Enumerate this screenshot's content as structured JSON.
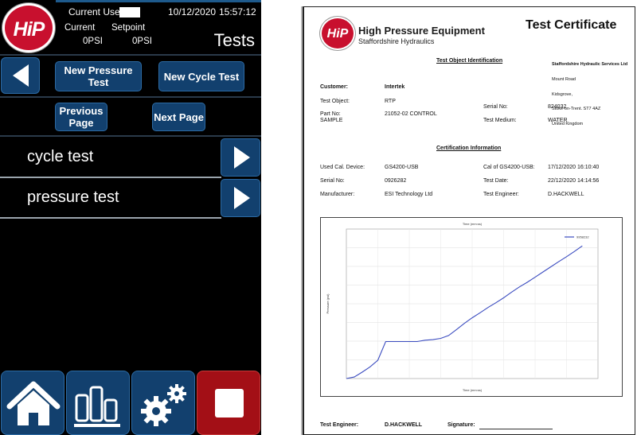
{
  "hmi": {
    "logo_text": "HiP",
    "current_user_label": "Current User",
    "date": "10/12/2020",
    "time": "15:57:12",
    "current_label": "Current",
    "setpoint_label": "Setpoint",
    "current_value": "0PSI",
    "setpoint_value": "0PSI",
    "screen_title": "Tests",
    "new_pressure_test_label": "New Pressure Test",
    "new_cycle_test_label": "New Cycle Test",
    "previous_page_label": "Previous Page",
    "next_page_label": "Next Page",
    "tests": [
      {
        "label": "cycle test"
      },
      {
        "label": "pressure test"
      }
    ],
    "bottom_nav": [
      "home-icon",
      "chart-icon",
      "settings-icon",
      "stop-icon"
    ],
    "colors": {
      "button": "#12406e",
      "stop": "#a30f16",
      "brand": "#c8102e"
    }
  },
  "certificate": {
    "logo_text": "HiP",
    "brand": "High Pressure Equipment",
    "brand_sub": "Staffordshire Hydraulics",
    "title": "Test Certificate",
    "address_lines": [
      "Staffordshire Hydraulic Services Ltd",
      "Mount Road",
      "Kidsgrove,",
      "Stoke-on-Trent. ST7 4AZ",
      "United Kingdom"
    ],
    "section_identification": "Test Object Identification",
    "customer_label": "Customer:",
    "customer": "Intertek",
    "test_object_label": "Test Object:",
    "test_object": "RTP",
    "part_no_label": "Part No:",
    "part_no_sub": "SAMPLE",
    "part_no": "21052-02 CONTROL",
    "serial_no_label": "Serial No:",
    "serial_no": "824032",
    "test_medium_label": "Test Medium:",
    "test_medium": "WATER",
    "section_certification": "Certification Information",
    "cal_device_label": "Used Cal. Device:",
    "cal_device": "GS4200-USB",
    "cal_of_label": "Cal of GS4200-USB:",
    "cal_of": "17/12/2020 16:10:40",
    "cal_serial_label": "Serial No:",
    "cal_serial": "0926282",
    "test_date_label": "Test Date:",
    "test_date": "22/12/2020 14:14:56",
    "manufacturer_label": "Manufacturer:",
    "manufacturer": "ESI Technology Ltd",
    "test_engineer_label": "Test Engineer:",
    "test_engineer": "D.HACKWELL",
    "footer_engineer_label": "Test Engineer:",
    "footer_engineer": "D.HACKWELL",
    "footer_signature_label": "Signature:"
  },
  "chart_data": {
    "type": "line",
    "title": "",
    "xlabel": "Time (mm:ss)",
    "top_xlabel": "Time (mm:ss)",
    "ylabel": "Pressure (psi)",
    "legend": "top-right",
    "grid": true,
    "series": [
      {
        "name": "9958232",
        "color": "#3b4cc0",
        "x": [
          0,
          1,
          2,
          3,
          4,
          5,
          6,
          7,
          8,
          9,
          10,
          11,
          12,
          13,
          14,
          15,
          16,
          17,
          18,
          19,
          20,
          21,
          22,
          23,
          24,
          25,
          26,
          27,
          28,
          29,
          30
        ],
        "y": [
          0.0,
          0.08,
          0.34,
          0.62,
          0.98,
          1.98,
          1.98,
          1.98,
          1.98,
          1.98,
          2.05,
          2.08,
          2.15,
          2.3,
          2.62,
          2.95,
          3.25,
          3.52,
          3.8,
          4.05,
          4.32,
          4.62,
          4.9,
          5.15,
          5.42,
          5.7,
          5.98,
          6.25,
          6.52,
          6.8,
          7.1
        ]
      }
    ],
    "xlim": [
      0,
      32
    ],
    "ylim": [
      0,
      8
    ]
  }
}
